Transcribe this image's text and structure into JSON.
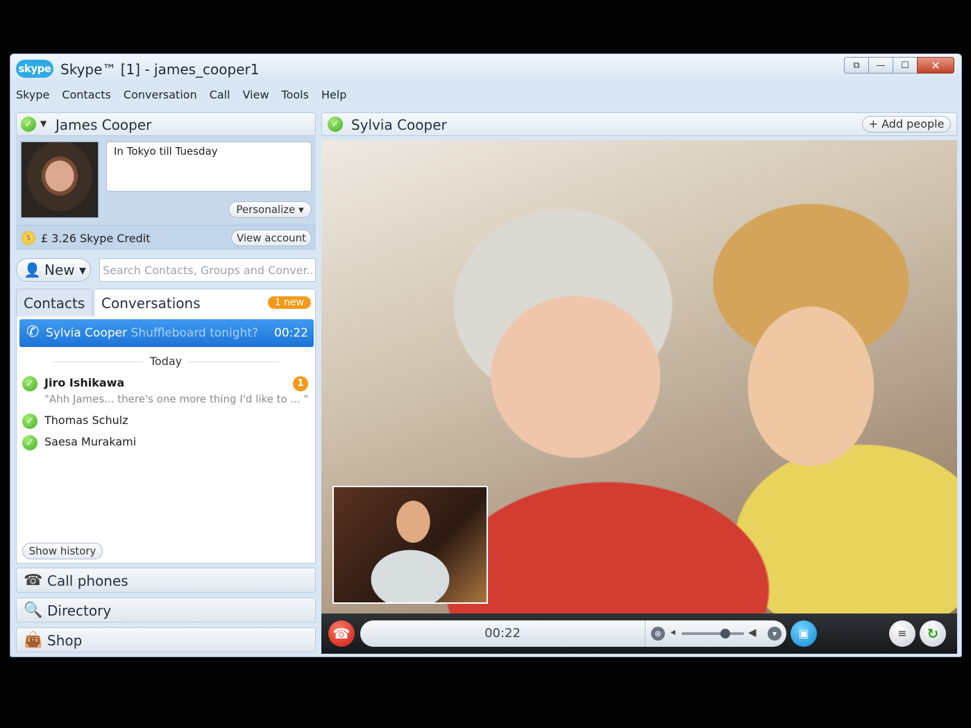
{
  "window": {
    "logo_text": "skype",
    "title": "Skype™ [1] - james_cooper1",
    "controls": {
      "restore": "⧉",
      "minimize": "—",
      "maximize": "☐",
      "close": "✕"
    }
  },
  "menu": [
    "Skype",
    "Contacts",
    "Conversation",
    "Call",
    "View",
    "Tools",
    "Help"
  ],
  "profile": {
    "name": "James Cooper",
    "mood": "In Tokyo till Tuesday",
    "personalize": "Personalize ▾",
    "credit": "£ 3.26 Skype Credit",
    "view_account": "View account"
  },
  "toolbar": {
    "new_label": "New ▾",
    "search_placeholder": "Search Contacts, Groups and Conver..."
  },
  "tabs": {
    "contacts": "Contacts",
    "conversations": "Conversations",
    "new_badge": "1 new"
  },
  "conversations": {
    "active": {
      "name": "Sylvia Cooper",
      "message": "Shuffleboard tonight?",
      "time": "00:22"
    },
    "today_label": "Today",
    "items": [
      {
        "name": "Jiro Ishikawa",
        "message": "\"Ahh James... there's one more thing I'd like to ... \"",
        "unread": "1"
      },
      {
        "name": "Thomas Schulz"
      },
      {
        "name": "Saesa Murakami"
      }
    ],
    "show_history": "Show history"
  },
  "nav": {
    "call_phones": "Call phones",
    "directory": "Directory",
    "shop": "Shop"
  },
  "call": {
    "contact": "Sylvia Cooper",
    "add_people": "+ Add people",
    "timer": "00:22",
    "volume_level": 0.7
  },
  "colors": {
    "accent": "#1c73d6",
    "status_online": "#3fae25",
    "badge": "#f39a1b",
    "hangup": "#c8180b"
  }
}
